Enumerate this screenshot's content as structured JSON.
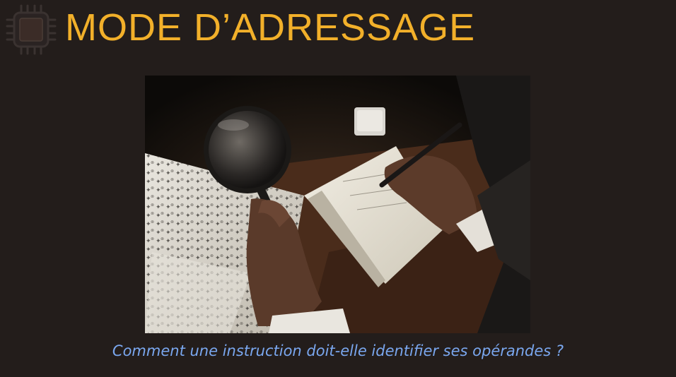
{
  "slide": {
    "title": "MODE D’ADRESSAGE",
    "caption": "Comment une instruction doit-elle identifier ses opérandes ?"
  },
  "logo": {
    "icon": "cpu-chip-icon"
  },
  "photo": {
    "subject": "magnifying-glass-icon"
  },
  "colors": {
    "background": "#231d1b",
    "title": "#f2b02a",
    "caption": "#7aa7ef"
  }
}
